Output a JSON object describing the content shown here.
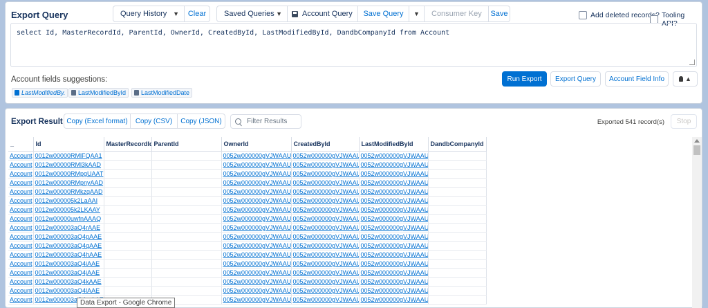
{
  "export_query": {
    "title": "Export Query",
    "query_history_label": "Query History",
    "clear_label": "Clear",
    "saved_queries_label": "Saved Queries",
    "query_name": "Account Query",
    "save_query_label": "Save Query",
    "consumer_key_placeholder": "Consumer Key",
    "save_label": "Save",
    "add_deleted_label": "Add deleted records?",
    "tooling_api_label": "Tooling API?",
    "soql": "select Id, MasterRecordId, ParentId, OwnerId, CreatedById, LastModifiedById, DandbCompanyId from Account",
    "suggestions_label": "Account fields suggestions:",
    "suggestions": [
      "LastModifiedBy.",
      "LastModifiedById",
      "LastModifiedDate"
    ],
    "run_export_label": "Run Export",
    "export_query_label": "Export Query",
    "field_info_label": "Account Field Info"
  },
  "export_result": {
    "title": "Export Result",
    "copy_excel_label": "Copy (Excel format)",
    "copy_csv_label": "Copy (CSV)",
    "copy_json_label": "Copy (JSON)",
    "filter_placeholder": "Filter Results",
    "exported_text": "Exported 541 record(s)",
    "stop_label": "Stop",
    "columns": [
      "_",
      "Id",
      "MasterRecordId",
      "ParentId",
      "OwnerId",
      "CreatedById",
      "LastModifiedById",
      "DandbCompanyId"
    ],
    "rows": [
      [
        "Account",
        "0012w00000RMlFQAA1",
        "",
        "",
        "0052w000000gVJWAAU",
        "0052w000000gVJWAAU",
        "0052w000000gVJWAAU",
        ""
      ],
      [
        "Account",
        "0012w00000RMl3kAAD",
        "",
        "",
        "0052w000000gVJWAAU",
        "0052w000000gVJWAAU",
        "0052w000000gVJWAAU",
        ""
      ],
      [
        "Account",
        "0012w00000RMpgUAAT",
        "",
        "",
        "0052w000000gVJWAAU",
        "0052w000000gVJWAAU",
        "0052w000000gVJWAAU",
        ""
      ],
      [
        "Account",
        "0012w00000RMpnyAAD",
        "",
        "",
        "0052w000000gVJWAAU",
        "0052w000000gVJWAAU",
        "0052w000000gVJWAAU",
        ""
      ],
      [
        "Account",
        "0012w00000RMkzqAAD",
        "",
        "",
        "0052w000000gVJWAAU",
        "0052w000000gVJWAAU",
        "0052w000000gVJWAAU",
        ""
      ],
      [
        "Account",
        "0012w000005k2LaAAI",
        "",
        "",
        "0052w000000gVJWAAU",
        "0052w000000gVJWAAU",
        "0052w000000gVJWAAU",
        ""
      ],
      [
        "Account",
        "0012w000005k2LKAAY",
        "",
        "",
        "0052w000000gVJWAAU",
        "0052w000000gVJWAAU",
        "0052w000000gVJWAAU",
        ""
      ],
      [
        "Account",
        "0012w00000uwfnAAAQ",
        "",
        "",
        "0052w000000gVJWAAU",
        "0052w000000gVJWAAU",
        "0052w000000gVJWAAU",
        ""
      ],
      [
        "Account",
        "0012w000003aQ4rAAE",
        "",
        "",
        "0052w000000gVJWAAU",
        "0052w000000gVJWAAU",
        "0052w000000gVJWAAU",
        ""
      ],
      [
        "Account",
        "0012w000003aQ4pAAE",
        "",
        "",
        "0052w000000gVJWAAU",
        "0052w000000gVJWAAU",
        "0052w000000gVJWAAU",
        ""
      ],
      [
        "Account",
        "0012w000003aQ4qAAE",
        "",
        "",
        "0052w000000gVJWAAU",
        "0052w000000gVJWAAU",
        "0052w000000gVJWAAU",
        ""
      ],
      [
        "Account",
        "0012w000003aQ4hAAE",
        "",
        "",
        "0052w000000gVJWAAU",
        "0052w000000gVJWAAU",
        "0052w000000gVJWAAU",
        ""
      ],
      [
        "Account",
        "0012w000003aQ4iAAE",
        "",
        "",
        "0052w000000gVJWAAU",
        "0052w000000gVJWAAU",
        "0052w000000gVJWAAU",
        ""
      ],
      [
        "Account",
        "0012w000003aQ4jAAE",
        "",
        "",
        "0052w000000gVJWAAU",
        "0052w000000gVJWAAU",
        "0052w000000gVJWAAU",
        ""
      ],
      [
        "Account",
        "0012w000003aQ4kAAE",
        "",
        "",
        "0052w000000gVJWAAU",
        "0052w000000gVJWAAU",
        "0052w000000gVJWAAU",
        ""
      ],
      [
        "Account",
        "0012w000003aQ4lAAE",
        "",
        "",
        "0052w000000gVJWAAU",
        "0052w000000gVJWAAU",
        "0052w000000gVJWAAU",
        ""
      ],
      [
        "Account",
        "0012w000003aQ4mAAE",
        "",
        "",
        "0052w000000gVJWAAU",
        "0052w000000gVJWAAU",
        "0052w000000gVJWAAU",
        ""
      ]
    ]
  },
  "tooltip": "Data Export - Google Chrome"
}
